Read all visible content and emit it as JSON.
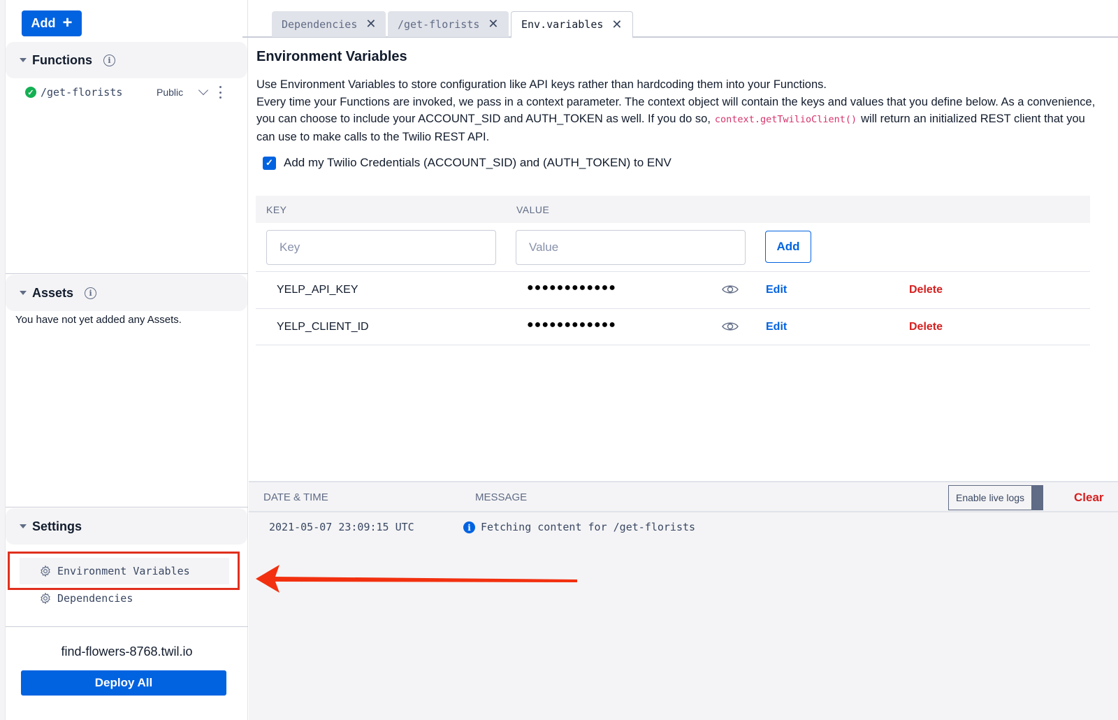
{
  "sidebar": {
    "add_button": "Add",
    "functions": {
      "title": "Functions",
      "items": [
        {
          "path": "/get-florists",
          "visibility": "Public",
          "status": "deployed"
        }
      ]
    },
    "assets": {
      "title": "Assets",
      "empty_text": "You have not yet added any Assets."
    },
    "settings": {
      "title": "Settings",
      "items": [
        {
          "label": "Environment Variables",
          "active": true,
          "highlighted": true
        },
        {
          "label": "Dependencies",
          "active": false
        }
      ]
    },
    "service_domain": "find-flowers-8768.twil.io",
    "deploy_button": "Deploy All"
  },
  "tabs": [
    {
      "label": "Dependencies",
      "active": false
    },
    {
      "label": "/get-florists",
      "active": false
    },
    {
      "label": "Env.variables",
      "active": true
    }
  ],
  "main": {
    "title": "Environment Variables",
    "description": {
      "line1": "Use Environment Variables to store configuration like API keys rather than hardcoding them into your Functions.",
      "line2_pre": "Every time your Functions are invoked, we pass in a context parameter. The context object will contain the keys and values that you define below. As a convenience, you can choose to include your ACCOUNT_SID and AUTH_TOKEN as well. If you do so,",
      "code": "context.getTwilioClient()",
      "line2_post": "will return an initialized REST client that you can use to make calls to the Twilio REST API."
    },
    "credentials_checkbox": {
      "label": "Add my Twilio Credentials (ACCOUNT_SID) and (AUTH_TOKEN) to ENV",
      "checked": true
    },
    "table": {
      "columns": [
        "KEY",
        "VALUE"
      ],
      "key_input": {
        "value": "",
        "placeholder": "Key"
      },
      "value_input": {
        "value": "",
        "placeholder": "Value"
      },
      "add_button": "Add",
      "rows": [
        {
          "key": "YELP_API_KEY",
          "value_masked": "●●●●●●●●●●●●",
          "edit": "Edit",
          "delete": "Delete"
        },
        {
          "key": "YELP_CLIENT_ID",
          "value_masked": "●●●●●●●●●●●●",
          "edit": "Edit",
          "delete": "Delete"
        }
      ]
    }
  },
  "logs": {
    "columns": [
      "DATE & TIME",
      "MESSAGE"
    ],
    "live_logs_toggle": {
      "label": "Enable live logs",
      "enabled": false
    },
    "clear_button": "Clear",
    "entries": [
      {
        "timestamp": "2021-05-07 23:09:15 UTC",
        "level": "info",
        "message": "Fetching content for /get-florists"
      }
    ]
  },
  "colors": {
    "brand_blue": "#0263e0",
    "danger_red": "#d61f1f",
    "success_green": "#14b053",
    "annotation_red": "#e0301e",
    "code_pink": "#d6336c"
  }
}
